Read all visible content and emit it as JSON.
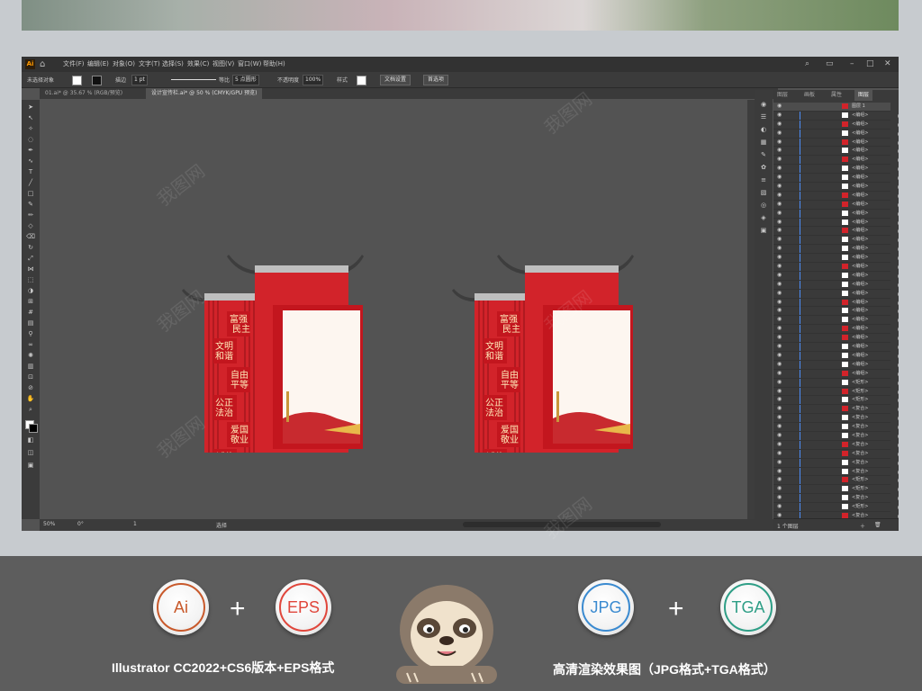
{
  "menubar": {
    "app_logo": "Ai",
    "items": [
      "文件(F)",
      "编辑(E)",
      "对象(O)",
      "文字(T)",
      "选择(S)",
      "效果(C)",
      "视图(V)",
      "窗口(W)",
      "帮助(H)"
    ],
    "icons": [
      "home-icon",
      "search-icon",
      "minimize-icon",
      "maximize-icon",
      "close-icon"
    ]
  },
  "control_bar": {
    "selection_label": "未选择对象",
    "stroke_label": "描边",
    "stroke_value": "1 pt",
    "stroke_profile": "等比",
    "brush_label": "5 点圆形",
    "opacity_label": "不透明度",
    "opacity_value": "100%",
    "style_label": "样式",
    "doc_setup_button": "文档设置",
    "preferences_button": "首选项"
  },
  "document_tabs": [
    {
      "label": "01.ai* @ 35.67 % (RGB/预览)",
      "active": false
    },
    {
      "label": "设计宣传栏.ai* @ 50 % (CMYK/GPU 预览)",
      "active": true
    }
  ],
  "statusbar": {
    "zoom": "50%",
    "rotation": "0°",
    "page": "1",
    "tool": "选择"
  },
  "layers_panel": {
    "tabs": [
      {
        "label": "图层",
        "active": false
      },
      {
        "label": "画板",
        "active": false
      },
      {
        "label": "属性",
        "active": false
      },
      {
        "label": "图层",
        "active": true
      }
    ],
    "top_layer": "图层 1",
    "rows": [
      "<编组>",
      "<编组>",
      "<编组>",
      "<编组>",
      "<编组>",
      "<编组>",
      "<编组>",
      "<编组>",
      "<编组>",
      "<编组>",
      "<编组>",
      "<编组>",
      "<编组>",
      "<编组>",
      "<编组>",
      "<编组>",
      "<编组>",
      "<编组>",
      "<编组>",
      "<编组>",
      "<编组>",
      "<编组>",
      "<编组>",
      "<编组>",
      "<编组>",
      "<编组>",
      "<编组>",
      "<编组>",
      "<编组>",
      "<编组>",
      "<矩形>",
      "<矩形>",
      "<矩形>",
      "<复合>",
      "<复合>",
      "<复合>",
      "<复合>",
      "<复合>",
      "<复合>",
      "<复合>",
      "<复合>",
      "<矩形>",
      "<矩形>",
      "<复合>",
      "<矩形>",
      "<复合>",
      "<矩形>",
      "<复合>",
      "<矩形>"
    ],
    "footer_label": "1 个图层"
  },
  "artboard": {
    "slogans": [
      [
        "富强",
        "民主"
      ],
      [
        "文明",
        "和谐"
      ],
      [
        "自由",
        "平等"
      ],
      [
        "公正",
        "法治"
      ],
      [
        "爱国",
        "敬业"
      ],
      [
        "诚信",
        "友善"
      ]
    ],
    "primary_color": "#d2232a",
    "dark_red": "#b01a20",
    "gray_cap": "#bfbfbf",
    "slogan_box_color": "#c3161e"
  },
  "bottom_band": {
    "badges": [
      {
        "text": "Ai",
        "color": "#c8592b"
      },
      {
        "text": "EPS",
        "color": "#e0463b"
      },
      {
        "text": "JPG",
        "color": "#3a8ad0"
      },
      {
        "text": "TGA",
        "color": "#2e9e86"
      }
    ],
    "plus": "+",
    "caption_left": "Illustrator CC2022+CS6版本+EPS格式",
    "caption_right": "高清渲染效果图（JPG格式+TGA格式）",
    "mascot": "sloth-mascot-icon"
  },
  "watermark_text": "我图网"
}
